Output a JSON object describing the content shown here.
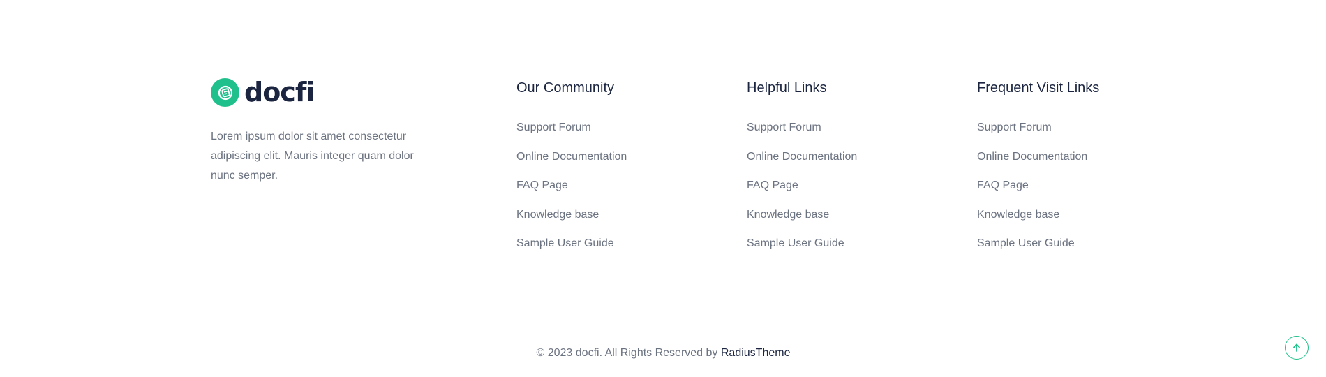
{
  "brand": {
    "logo_text": "docfi",
    "description": "Lorem ipsum dolor sit amet consectetur adipiscing elit. Mauris integer quam dolor nunc semper."
  },
  "columns": [
    {
      "title": "Our Community",
      "links": [
        "Support Forum",
        "Online Documentation",
        "FAQ Page",
        "Knowledge base",
        "Sample User Guide"
      ]
    },
    {
      "title": "Helpful Links",
      "links": [
        "Support Forum",
        "Online Documentation",
        "FAQ Page",
        "Knowledge base",
        "Sample User Guide"
      ]
    },
    {
      "title": "Frequent Visit Links",
      "links": [
        "Support Forum",
        "Online Documentation",
        "FAQ Page",
        "Knowledge base",
        "Sample User Guide"
      ]
    }
  ],
  "copyright": {
    "text": "© 2023 docfi. All Rights Reserved by ",
    "author": "RadiusTheme"
  },
  "icons": {
    "logo": "docfi-logo-icon",
    "back_to_top": "arrow-up-icon"
  },
  "colors": {
    "accent": "#1fc08b",
    "heading": "#1b2540",
    "text": "#6b7280",
    "divider": "#e5e7eb"
  }
}
